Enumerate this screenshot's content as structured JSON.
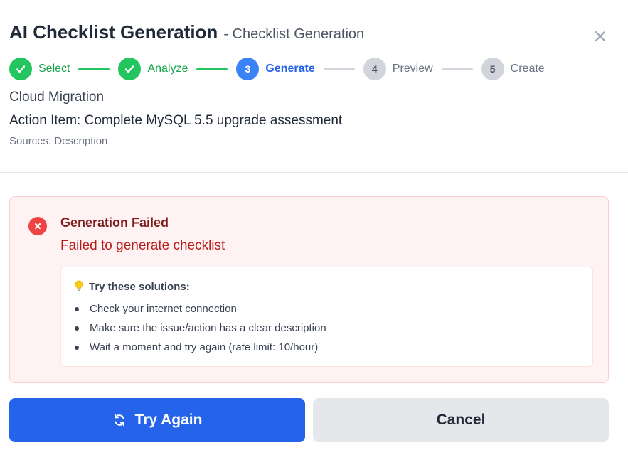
{
  "dialog": {
    "title": "AI Checklist Generation",
    "subtitle": "- Checklist Generation",
    "close_icon": "close-icon"
  },
  "stepper": {
    "steps": [
      {
        "number": "1",
        "label": "Select",
        "state": "done"
      },
      {
        "number": "2",
        "label": "Analyze",
        "state": "done"
      },
      {
        "number": "3",
        "label": "Generate",
        "state": "active"
      },
      {
        "number": "4",
        "label": "Preview",
        "state": "pending"
      },
      {
        "number": "5",
        "label": "Create",
        "state": "pending"
      }
    ]
  },
  "context": {
    "project": "Cloud Migration",
    "action_item": "Action Item: Complete MySQL 5.5 upgrade assessment",
    "sources": "Sources: Description"
  },
  "error": {
    "icon": "x-circle-icon",
    "title": "Generation Failed",
    "message": "Failed to generate checklist",
    "solutions_icon": "lightbulb-icon",
    "solutions_title": "Try these solutions:",
    "solutions": [
      "Check your internet connection",
      "Make sure the issue/action has a clear description",
      "Wait a moment and try again (rate limit: 10/hour)"
    ]
  },
  "actions": {
    "retry_icon": "refresh-icon",
    "retry_label": "Try Again",
    "cancel_label": "Cancel"
  },
  "colors": {
    "success": "#22c55e",
    "active": "#3b82f6",
    "primary_button": "#2563eb",
    "error": "#ef4444",
    "error_bg": "#fef2f2"
  }
}
